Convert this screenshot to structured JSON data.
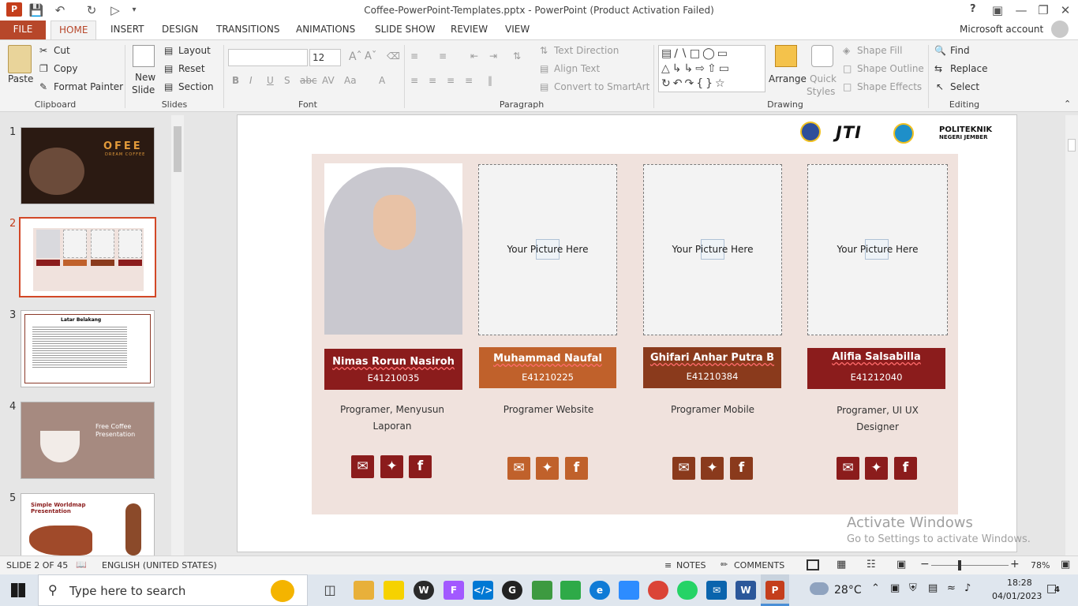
{
  "app": {
    "title": "Coffee-PowerPoint-Templates.pptx - PowerPoint (Product Activation Failed)",
    "account": "Microsoft account",
    "help": "?"
  },
  "tabs": [
    "FILE",
    "HOME",
    "INSERT",
    "DESIGN",
    "TRANSITIONS",
    "ANIMATIONS",
    "SLIDE SHOW",
    "REVIEW",
    "VIEW"
  ],
  "ribbon": {
    "clipboard": {
      "paste": "Paste",
      "cut": "Cut",
      "copy": "Copy",
      "format_painter": "Format Painter",
      "label": "Clipboard"
    },
    "slides": {
      "new_slide_1": "New",
      "new_slide_2": "Slide",
      "layout": "Layout",
      "reset": "Reset",
      "section": "Section",
      "label": "Slides"
    },
    "font": {
      "family": "",
      "size": "12",
      "label": "Font"
    },
    "paragraph": {
      "text_direction": "Text Direction",
      "align_text": "Align Text",
      "convert_smartart": "Convert to SmartArt",
      "label": "Paragraph"
    },
    "drawing": {
      "arrange": "Arrange",
      "quick_styles_1": "Quick",
      "quick_styles_2": "Styles",
      "shape_fill": "Shape Fill",
      "shape_outline": "Shape Outline",
      "shape_effects": "Shape Effects",
      "label": "Drawing"
    },
    "editing": {
      "find": "Find",
      "replace": "Replace",
      "select": "Select",
      "label": "Editing"
    }
  },
  "thumbnails": [
    {
      "num": "1",
      "title": "OFEE",
      "sub": "DREAM COFFEE"
    },
    {
      "num": "2"
    },
    {
      "num": "3",
      "title": "Latar Belakang"
    },
    {
      "num": "4",
      "title": "Free Coffee Presentation"
    },
    {
      "num": "5",
      "title": "Simple Worldmap Presentation"
    }
  ],
  "slide": {
    "logo_jti": "JTI",
    "logo_poltek_1": "POLITEKNIK",
    "logo_poltek_2": "NEGERI JEMBER",
    "placeholder": "Your Picture Here",
    "members": [
      {
        "name": "Nimas Rorun Nasiroh",
        "id": "E41210035",
        "role_1": "Programer, Menyusun",
        "role_2": "Laporan",
        "color": "#8b1c1c"
      },
      {
        "name": "Muhammad Naufal",
        "id": "E41210225",
        "role_1": "Programer Website",
        "role_2": "",
        "color": "#c0612b"
      },
      {
        "name": "Ghifari Anhar Putra B",
        "id": "E41210384",
        "role_1": "Programer Mobile",
        "role_2": "",
        "color": "#8a3a1c"
      },
      {
        "name": "Alifia Salsabilla",
        "id": "E41212040",
        "role_1": "Programer, UI UX",
        "role_2": "Designer",
        "color": "#8b1c1c"
      }
    ],
    "social_colors": [
      "#8b1c1c",
      "#c0612b",
      "#8a3a1c",
      "#8b1c1c"
    ]
  },
  "watermark": {
    "line1": "Activate Windows",
    "line2": "Go to Settings to activate Windows."
  },
  "status": {
    "slide_of": "SLIDE 2 OF 45",
    "language": "ENGLISH (UNITED STATES)",
    "notes": "NOTES",
    "comments": "COMMENTS",
    "zoom": "78%"
  },
  "taskbar": {
    "search": "Type here to search",
    "temp": "28°C",
    "time": "18:28",
    "date": "04/01/2023",
    "notif": "4"
  }
}
